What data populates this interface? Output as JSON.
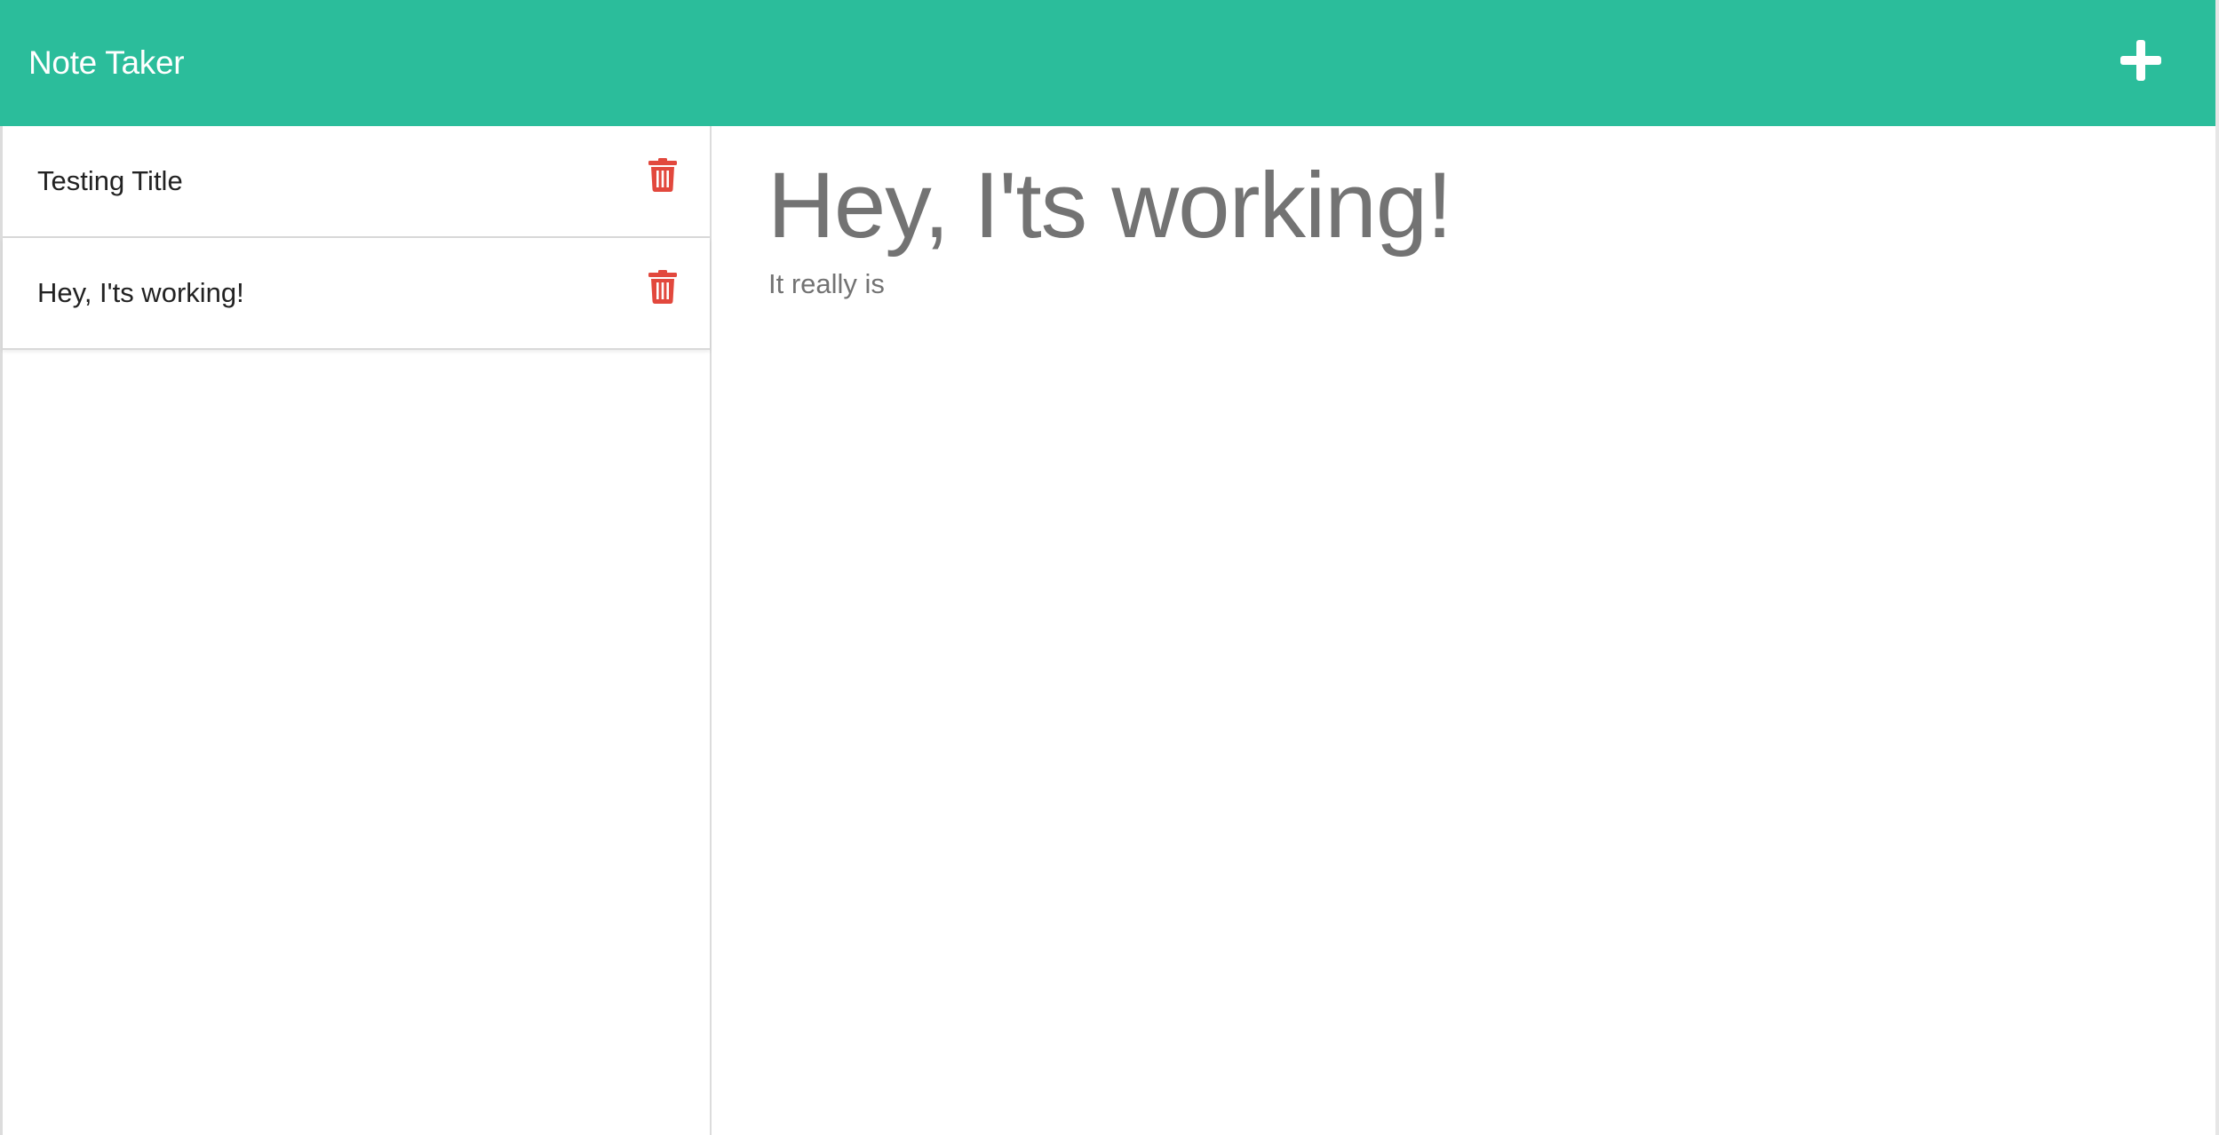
{
  "navbar": {
    "brand": "Note Taker",
    "new_note_icon": "plus-icon",
    "background_color": "#2bbd9b"
  },
  "sidebar": {
    "notes": [
      {
        "title": "Testing Title",
        "delete_icon": "trash-icon"
      },
      {
        "title": "Hey, I'ts working!",
        "delete_icon": "trash-icon"
      }
    ],
    "delete_icon_color": "#e2483d"
  },
  "editor": {
    "title": "Hey, I'ts working!",
    "body": "It really is"
  }
}
